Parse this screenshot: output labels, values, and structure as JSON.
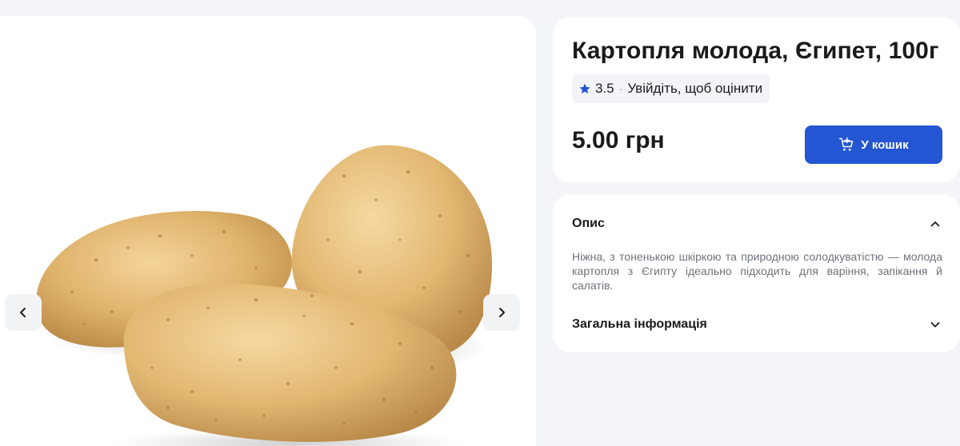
{
  "gallery": {
    "image_alt": "potatoes-image",
    "prev_icon": "chevron-left-icon",
    "next_icon": "chevron-right-icon"
  },
  "product": {
    "title": "Картопля молода, Єгипет, 100г",
    "rating": {
      "star_icon": "star-icon",
      "score": "3.5",
      "separator": "·",
      "login_prompt": "Увійдіть, щоб оцінити"
    },
    "price": "5.00 грн",
    "cart_button": {
      "label": "У кошик",
      "icon": "cart-add-icon"
    }
  },
  "details": {
    "description": {
      "title": "Опис",
      "expanded": true,
      "icon": "chevron-up-icon",
      "text": "Ніжна, з тоненькою шкіркою та природною солодкуватістю — молода картопля з Єгипту ідеально підходить для варіння, запікання й салатів."
    },
    "general_info": {
      "title": "Загальна інформація",
      "expanded": false,
      "icon": "chevron-down-icon"
    }
  },
  "colors": {
    "page_background": "#f3f5f9",
    "accent": "#2456d3",
    "star": "#2456d3",
    "muted_text": "#6e737c"
  }
}
